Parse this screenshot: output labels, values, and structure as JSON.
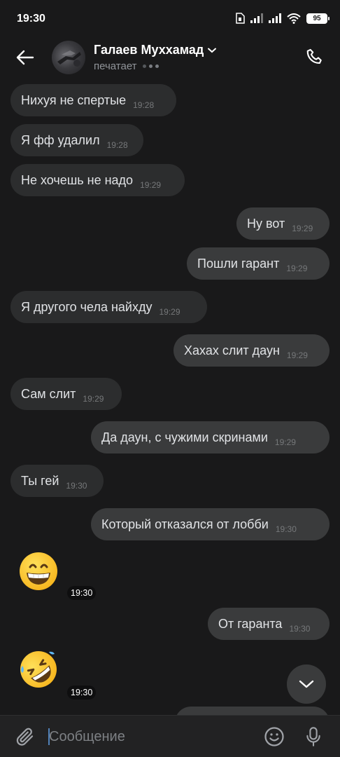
{
  "status_bar": {
    "time": "19:30",
    "battery": "95"
  },
  "header": {
    "contact_name": "Галаев Муххамад",
    "status": "печатает"
  },
  "messages": [
    {
      "side": "in",
      "text": "Нихуя не спертые",
      "time": "19:28"
    },
    {
      "side": "in",
      "text": "Я фф удалил",
      "time": "19:28"
    },
    {
      "side": "in",
      "text": "Не хочешь не надо",
      "time": "19:29"
    },
    {
      "side": "out",
      "text": "Ну вот",
      "time": "19:29"
    },
    {
      "side": "out",
      "text": "Пошли гарант",
      "time": "19:29"
    },
    {
      "side": "in",
      "text": "Я другого чела найхду",
      "time": "19:29"
    },
    {
      "side": "out",
      "text": "Хахах слит даун",
      "time": "19:29"
    },
    {
      "side": "in",
      "text": "Сам слит",
      "time": "19:29"
    },
    {
      "side": "out",
      "text": "Да даун, с чужими скринами",
      "time": "19:29"
    },
    {
      "side": "in",
      "text": "Ты гей",
      "time": "19:30"
    },
    {
      "side": "out",
      "text": "Который отказался от лобби",
      "time": "19:30"
    },
    {
      "side": "in",
      "emoji": "grinning-face",
      "time": "19:30"
    },
    {
      "side": "out",
      "text": "От гаранта",
      "time": "19:30"
    },
    {
      "side": "in",
      "emoji": "rolling-on-floor-laughing",
      "time": "19:30"
    }
  ],
  "composer": {
    "placeholder": "Сообщение"
  },
  "colors": {
    "background": "#19191a",
    "bubble_in": "#2c2d2e",
    "bubble_out": "#3a3b3c",
    "accent": "#5181b8"
  }
}
